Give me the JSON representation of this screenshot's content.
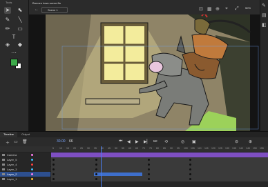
{
  "tools_panel": {
    "title": "Tools"
  },
  "document": {
    "tab_label": "Bremen town scene.fla",
    "scene_label": "Scene 1",
    "zoom": "50%"
  },
  "timeline": {
    "tab_timeline": "Timeline",
    "tab_output": "Output",
    "fps": "30.00",
    "current_frame": "66",
    "ruler_numbers": [
      "5",
      "10",
      "15",
      "20",
      "25",
      "30",
      "35",
      "40",
      "45",
      "50",
      "55",
      "60",
      "65",
      "70",
      "75",
      "80",
      "85",
      "90",
      "95",
      "100",
      "105",
      "110",
      "115",
      "120",
      "125",
      "130",
      "135",
      "140",
      "145",
      "150",
      "155"
    ],
    "layers": [
      {
        "name": "Camera",
        "dot": "#ff7bf0"
      },
      {
        "name": "Layer_5",
        "dot": "#3fbfff"
      },
      {
        "name": "Layer_4",
        "dot": "#ff4040"
      },
      {
        "name": "Layer_3",
        "dot": "#3fbfff"
      },
      {
        "name": "Layer_2",
        "dot": "#ff7bf0"
      },
      {
        "name": "Layer_1",
        "dot": "#ffbf2f"
      }
    ]
  },
  "colors": {
    "accent": "#4a7ef5",
    "camera_track": "#7e4fc2",
    "fill_swatch": "#3dab4a"
  }
}
